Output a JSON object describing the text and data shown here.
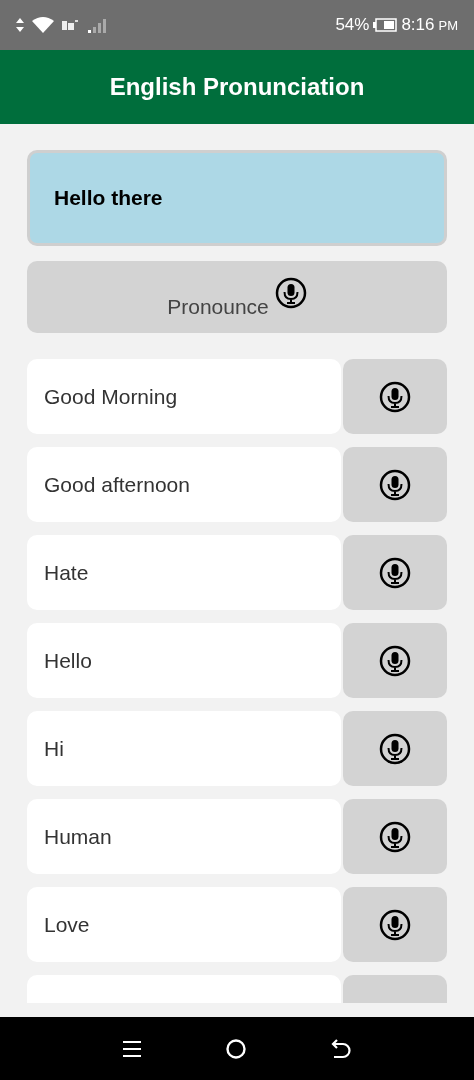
{
  "status_bar": {
    "battery_text": "54%",
    "time": "8:16",
    "time_suffix": "PM"
  },
  "app_bar": {
    "title": "English Pronunciation"
  },
  "input": {
    "value": "Hello there"
  },
  "pronounce_button": {
    "label": "Pronounce"
  },
  "phrases": [
    {
      "kind": "row",
      "text": "Good Morning"
    },
    {
      "kind": "row",
      "text": "Good afternoon"
    },
    {
      "kind": "row",
      "text": "Hate"
    },
    {
      "kind": "row",
      "text": "Hello"
    },
    {
      "kind": "row",
      "text": "Hi"
    },
    {
      "kind": "row",
      "text": "Human"
    },
    {
      "kind": "row",
      "text": "Love"
    },
    {
      "kind": "cut"
    }
  ]
}
